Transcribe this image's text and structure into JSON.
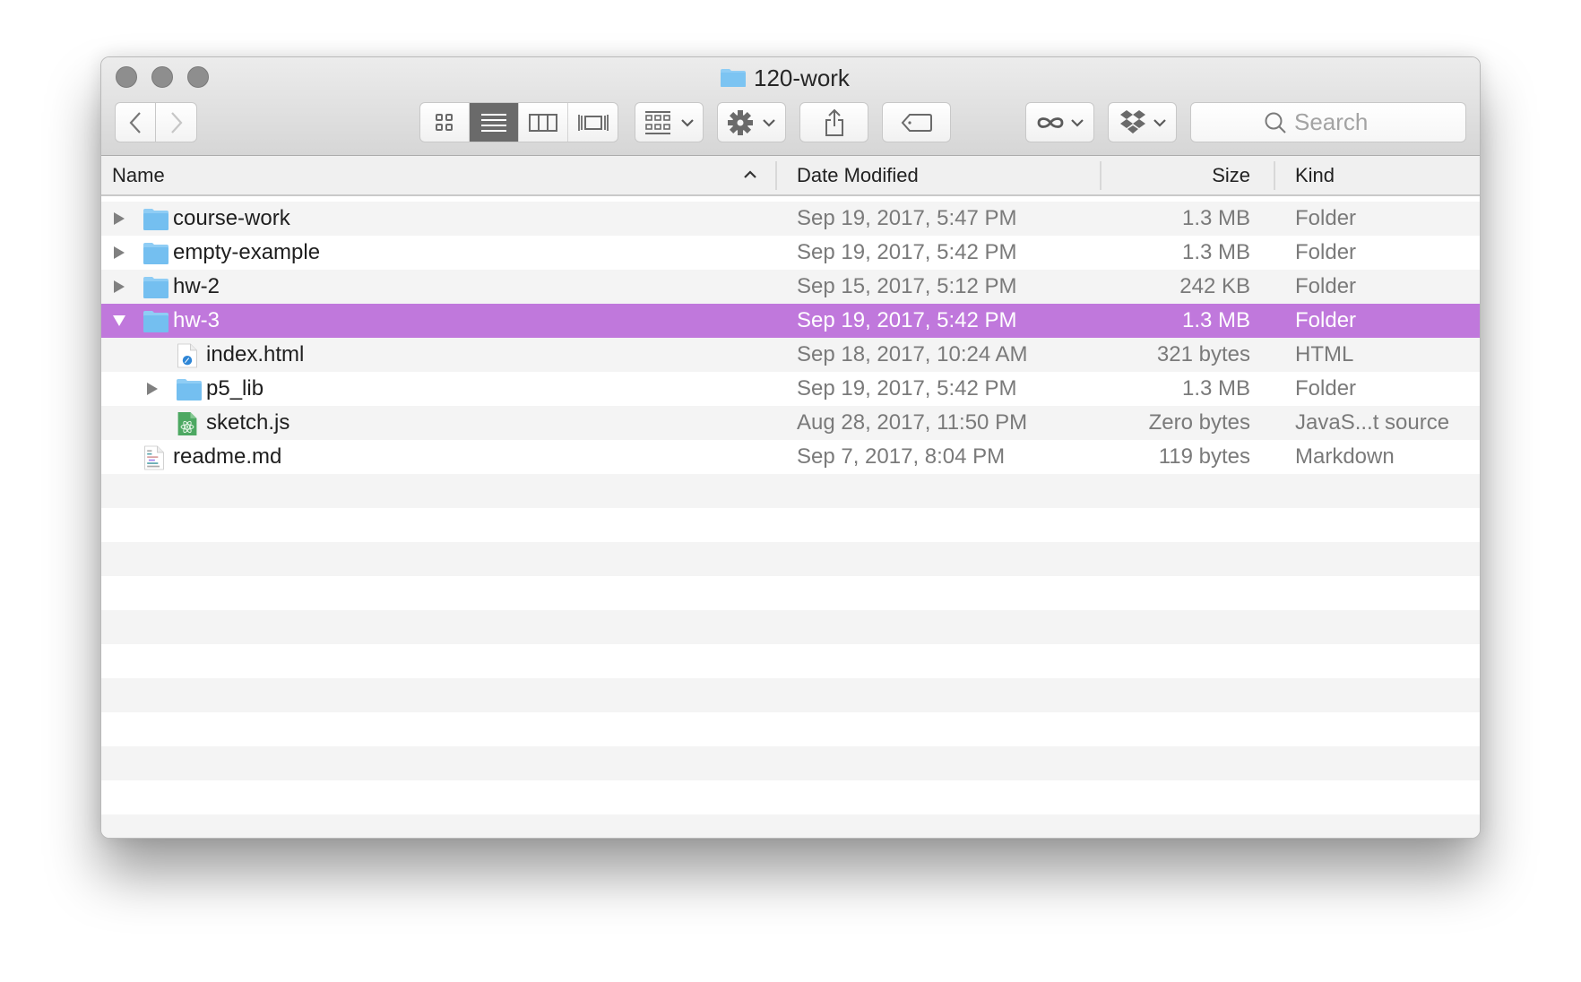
{
  "window": {
    "title": "120-work",
    "title_icon": "folder-icon"
  },
  "toolbar": {
    "back": {
      "icon": "chevron-left-icon",
      "enabled": true
    },
    "forward": {
      "icon": "chevron-right-icon",
      "enabled": false
    },
    "view_modes": [
      {
        "name": "icon-view",
        "icon": "grid-icon",
        "active": false
      },
      {
        "name": "list-view",
        "icon": "list-icon",
        "active": true
      },
      {
        "name": "column-view",
        "icon": "columns-icon",
        "active": false
      },
      {
        "name": "cover-flow-view",
        "icon": "cover-flow-icon",
        "active": false
      }
    ],
    "arrange": {
      "icon": "arrange-grid-icon",
      "has_dropdown": true
    },
    "action": {
      "icon": "gear-icon",
      "has_dropdown": true
    },
    "share": {
      "icon": "share-icon"
    },
    "tags": {
      "icon": "tag-icon"
    },
    "extension1": {
      "icon": "infinity-icon",
      "has_dropdown": true
    },
    "dropbox": {
      "icon": "dropbox-icon",
      "has_dropdown": true
    },
    "search": {
      "placeholder": "Search",
      "value": ""
    }
  },
  "columns": {
    "name": "Name",
    "date_modified": "Date Modified",
    "size": "Size",
    "kind": "Kind",
    "sort_column": "name",
    "sort_direction": "ascending"
  },
  "rows": [
    {
      "name": "course-work",
      "date": "Sep 19, 2017, 5:47 PM",
      "size": "1.3 MB",
      "kind": "Folder",
      "icon": "folder-icon",
      "depth": 0,
      "disclosure": "collapsed",
      "selected": false
    },
    {
      "name": "empty-example",
      "date": "Sep 19, 2017, 5:42 PM",
      "size": "1.3 MB",
      "kind": "Folder",
      "icon": "folder-icon",
      "depth": 0,
      "disclosure": "collapsed",
      "selected": false
    },
    {
      "name": "hw-2",
      "date": "Sep 15, 2017, 5:12 PM",
      "size": "242 KB",
      "kind": "Folder",
      "icon": "folder-icon",
      "depth": 0,
      "disclosure": "collapsed",
      "selected": false
    },
    {
      "name": "hw-3",
      "date": "Sep 19, 2017, 5:42 PM",
      "size": "1.3 MB",
      "kind": "Folder",
      "icon": "folder-icon",
      "depth": 0,
      "disclosure": "expanded",
      "selected": true
    },
    {
      "name": "index.html",
      "date": "Sep 18, 2017, 10:24 AM",
      "size": "321 bytes",
      "kind": "HTML",
      "icon": "html-file-icon",
      "depth": 1,
      "disclosure": "none",
      "selected": false
    },
    {
      "name": "p5_lib",
      "date": "Sep 19, 2017, 5:42 PM",
      "size": "1.3 MB",
      "kind": "Folder",
      "icon": "folder-icon",
      "depth": 1,
      "disclosure": "collapsed",
      "selected": false
    },
    {
      "name": "sketch.js",
      "date": "Aug 28, 2017, 11:50 PM",
      "size": "Zero bytes",
      "kind": "JavaS...t source",
      "icon": "js-file-icon",
      "depth": 1,
      "disclosure": "none",
      "selected": false
    },
    {
      "name": "readme.md",
      "date": "Sep 7, 2017, 8:04 PM",
      "size": "119 bytes",
      "kind": "Markdown",
      "icon": "markdown-file-icon",
      "depth": 0,
      "disclosure": "none",
      "selected": false
    }
  ],
  "colors": {
    "selection": "#c078dc",
    "folder": "#7cc4f2",
    "stripe": "#f4f4f4"
  }
}
